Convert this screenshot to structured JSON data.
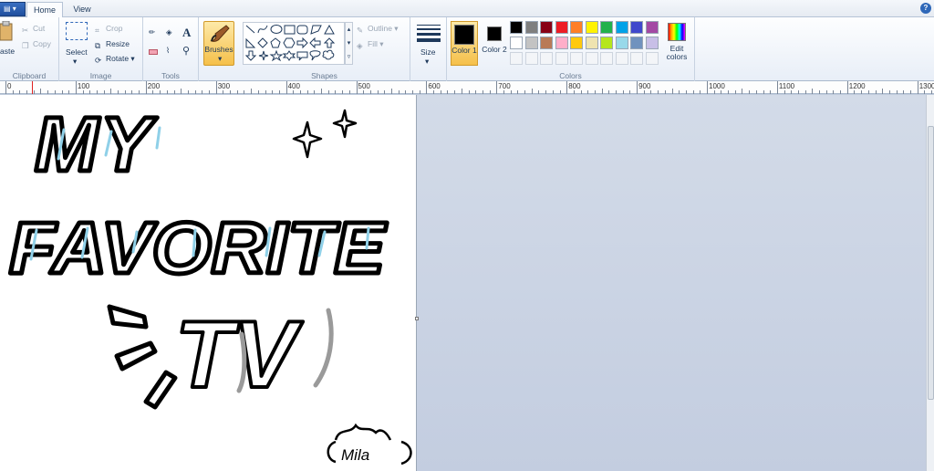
{
  "app": {
    "menu_glyph": "▾"
  },
  "tabs": [
    {
      "label": "Home",
      "active": true
    },
    {
      "label": "View",
      "active": false
    }
  ],
  "help_label": "?",
  "groups": {
    "clipboard": {
      "label": "Clipboard",
      "paste_label": "aste",
      "cut_label": "Cut",
      "copy_label": "Copy"
    },
    "image": {
      "label": "Image",
      "select_label": "Select",
      "crop_label": "Crop",
      "resize_label": "Resize",
      "rotate_label": "Rotate"
    },
    "tools": {
      "label": "Tools",
      "text_tool_glyph": "A"
    },
    "brushes": {
      "label": "Brushes"
    },
    "shapes": {
      "label": "Shapes",
      "outline_label": "Outline",
      "fill_label": "Fill"
    },
    "size": {
      "label": "Size"
    },
    "colors": {
      "label": "Colors",
      "color1_label": "Color 1",
      "color2_label": "Color 2",
      "edit_label": "Edit colors",
      "color1": "#000000",
      "color2": "#000000",
      "row1": [
        "#000000",
        "#7f7f7f",
        "#880015",
        "#ed1c24",
        "#ff7f27",
        "#fff200",
        "#22b14c",
        "#00a2e8",
        "#3f48cc",
        "#a349a4"
      ],
      "row2": [
        "#ffffff",
        "#c3c3c3",
        "#b97a57",
        "#ffaec9",
        "#ffc90e",
        "#efe4b0",
        "#b5e61d",
        "#99d9ea",
        "#7092be",
        "#c8bfe7"
      ]
    }
  },
  "ruler": {
    "labels": [
      "0",
      "100",
      "200",
      "300",
      "400",
      "500",
      "600",
      "700",
      "800",
      "900",
      "1000",
      "1100",
      "1200",
      "1300"
    ]
  },
  "drawing": {
    "line1": "MY",
    "line2": "FAVORITE",
    "line3": "TV",
    "signature": "Mila"
  }
}
